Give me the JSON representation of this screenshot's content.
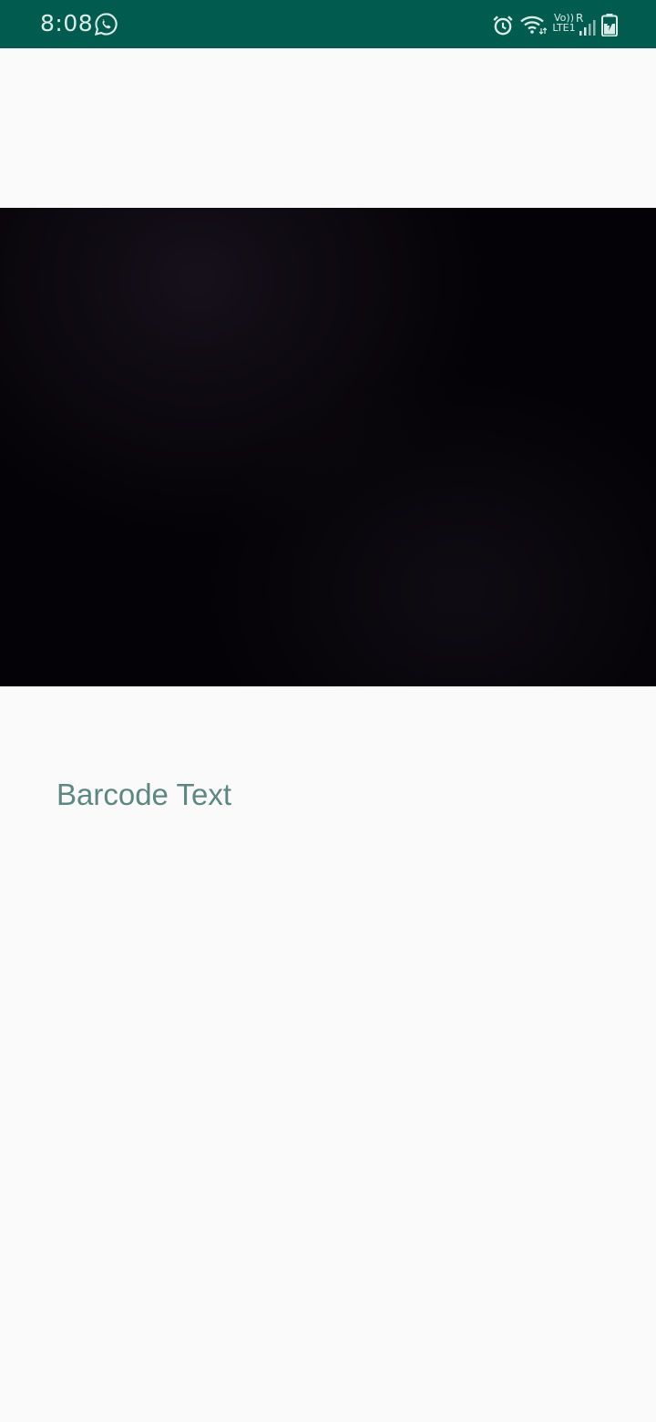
{
  "status_bar": {
    "time": "8:08",
    "volte": "Vo))",
    "lte": "LTE1",
    "roaming": "R",
    "icons": [
      "whatsapp-icon",
      "alarm-icon",
      "wifi-icon",
      "signal-icon",
      "battery-icon"
    ],
    "background_color": "#025b4f"
  },
  "camera_preview": {
    "background_color": "#040206"
  },
  "result": {
    "barcode_text": "Barcode Text",
    "text_color": "#5e8782"
  }
}
